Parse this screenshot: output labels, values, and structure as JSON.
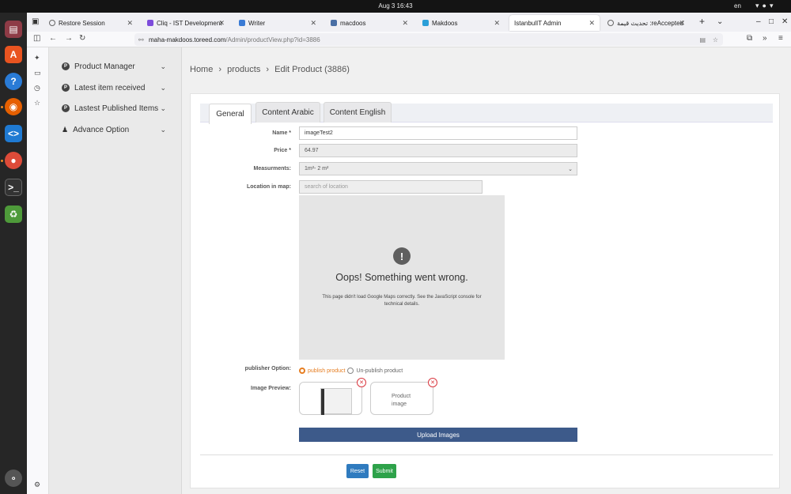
{
  "topbar": {
    "clock": "Aug 3  16:43",
    "lang": "en"
  },
  "dock": {
    "items": [
      "files-icon",
      "app-center-icon",
      "help-icon",
      "firefox-icon",
      "vscode-icon",
      "chrome-icon",
      "terminal-icon",
      "trash-icon",
      "show-apps-icon"
    ]
  },
  "browser": {
    "tabs": [
      {
        "label": "Restore Session"
      },
      {
        "label": "Cliq - IST Development"
      },
      {
        "label": "Writer"
      },
      {
        "label": "macdoos"
      },
      {
        "label": "Makdoos"
      },
      {
        "label": "IstanbulIT Admin"
      },
      {
        "label": "تحديث قيمة :reAccepted"
      }
    ],
    "url_host": "maha-makdoos.toreed.com",
    "url_path": "/Admin/productView.php?id=3886"
  },
  "sidebar": {
    "items": [
      {
        "label": "Product Manager"
      },
      {
        "label": "Latest item received"
      },
      {
        "label": "Lastest Published Items"
      },
      {
        "label": "Advance Option"
      }
    ]
  },
  "breadcrumb": {
    "home": "Home",
    "products": "products",
    "current": "Edit Product (3886)"
  },
  "form": {
    "tabs": [
      "General",
      "Content Arabic",
      "Content English"
    ],
    "name_label": "Name *",
    "name_value": "imageTest2",
    "price_label": "Price *",
    "price_value": "64.97",
    "measure_label": "Measurments:",
    "measure_value": "1m²- 2 m²",
    "location_label": "Location in map:",
    "location_placeholder": "search of location",
    "map_error_title": "Oops! Something went wrong.",
    "map_error_text": "This page didn't load Google Maps correctly. See the JavaScript console for technical details.",
    "publisher_label": "publisher Option:",
    "publish_option": "publish product",
    "unpublish_option": "Un-publish product",
    "image_label": "Image Preview:",
    "product_image_caption": "Product image",
    "upload_label": "Upload Images",
    "reset_label": "Reset",
    "submit_label": "Submit"
  },
  "colors": {
    "upload": "#3d5a8a",
    "reset": "#2f7bbf",
    "submit": "#2ea24a",
    "radio": "#e67e22",
    "remove": "#d9363e"
  }
}
